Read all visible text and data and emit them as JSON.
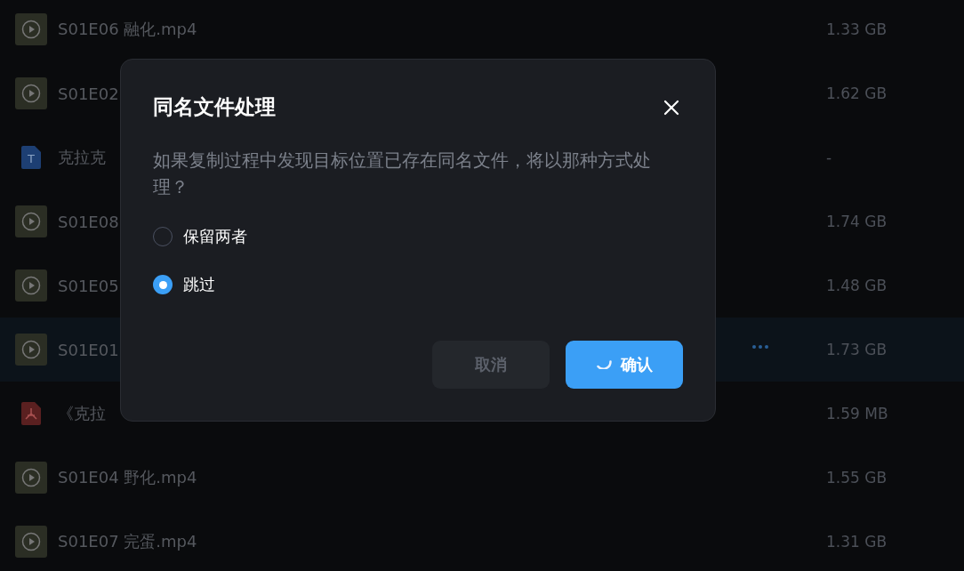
{
  "files": [
    {
      "kind": "video",
      "name": "S01E06 融化.mp4",
      "size": "1.33 GB",
      "selected": false
    },
    {
      "kind": "video",
      "name": "S01E02",
      "size": "1.62 GB",
      "selected": false
    },
    {
      "kind": "doc",
      "icon_letter": "T",
      "name": "克拉克",
      "size": "-",
      "selected": false
    },
    {
      "kind": "video",
      "name": "S01E08",
      "size": "1.74 GB",
      "selected": false
    },
    {
      "kind": "video",
      "name": "S01E05",
      "size": "1.48 GB",
      "selected": false
    },
    {
      "kind": "video",
      "name": "S01E01",
      "size": "1.73 GB",
      "selected": true
    },
    {
      "kind": "pdf",
      "name": "《克拉",
      "size": "1.59 MB",
      "selected": false
    },
    {
      "kind": "video",
      "name": "S01E04 野化.mp4",
      "size": "1.55 GB",
      "selected": false
    },
    {
      "kind": "video",
      "name": "S01E07 完蛋.mp4",
      "size": "1.31 GB",
      "selected": false
    }
  ],
  "dialog": {
    "title": "同名文件处理",
    "message": "如果复制过程中发现目标位置已存在同名文件，将以那种方式处理？",
    "options": [
      {
        "label": "保留两者",
        "selected": false
      },
      {
        "label": "跳过",
        "selected": true
      }
    ],
    "cancel": {
      "label": "取消",
      "disabled": true
    },
    "confirm": {
      "label": "确认",
      "loading": true
    }
  }
}
